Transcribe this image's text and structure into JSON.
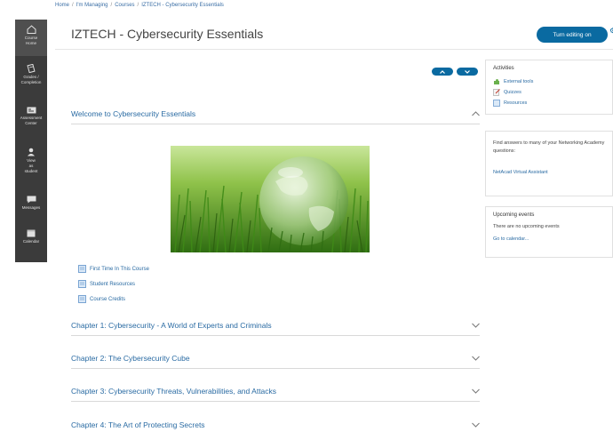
{
  "breadcrumb": {
    "home": "Home",
    "managing": "I'm Managing",
    "courses": "Courses",
    "course": "IZTECH - Cybersecurity Essentials"
  },
  "sidebar": {
    "items": [
      {
        "line1": "Course",
        "line2": "Home",
        "icon": "home-icon"
      },
      {
        "line1": "Grades /",
        "line2": "Completion",
        "icon": "grades-icon"
      },
      {
        "line1": "Assessment",
        "line2": "Center",
        "icon": "assessment-icon"
      },
      {
        "line1": "View",
        "line2": "as",
        "line3": "student",
        "icon": "user-icon"
      },
      {
        "line1": "Messages",
        "icon": "message-icon"
      },
      {
        "line1": "Calendar",
        "icon": "calendar-icon"
      }
    ]
  },
  "page": {
    "title": "IZTECH - Cybersecurity Essentials",
    "edit_button": "Turn editing on"
  },
  "sections": {
    "welcome": "Welcome to Cybersecurity Essentials",
    "ch1": "Chapter 1: Cybersecurity - A World of Experts and Criminals",
    "ch2": "Chapter 2: The Cybersecurity Cube",
    "ch3": "Chapter 3: Cybersecurity Threats, Vulnerabilities, and Attacks",
    "ch4": "Chapter 4: The Art of Protecting Secrets"
  },
  "resources": {
    "first_time": "First Time In This Course",
    "student": "Student Resources",
    "credits": "Course Credits"
  },
  "activities": {
    "title": "Activities",
    "external": "External tools",
    "quizzes": "Quizzes",
    "resources": "Resources"
  },
  "help": {
    "text": "Find answers to many of your Networking Academy questions:",
    "link": "NetAcad Virtual Assistant"
  },
  "events": {
    "title": "Upcoming events",
    "none": "There are no upcoming events",
    "link": "Go to calendar..."
  },
  "colors": {
    "accent": "#0a6aa1",
    "link": "#2a6ba3",
    "sidebar": "#3b3b3b"
  }
}
